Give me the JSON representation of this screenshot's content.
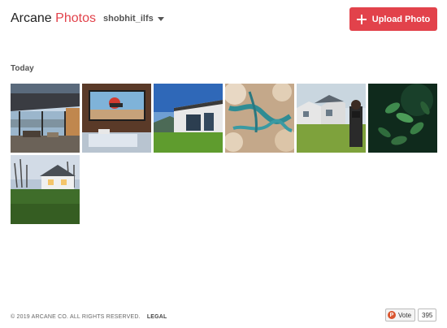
{
  "header": {
    "brand_part1": "Arcane",
    "brand_part2": "Photos",
    "username": "shobhit_ilfs",
    "upload_label": "Upload Photo"
  },
  "colors": {
    "accent": "#e2424b",
    "text_dark": "#1f1f1f"
  },
  "gallery": {
    "section_title": "Today",
    "photos": [
      {
        "subject": "modern-house-interior"
      },
      {
        "subject": "tv-room-motocross"
      },
      {
        "subject": "modern-house-lawn"
      },
      {
        "subject": "aerial-river-clouds"
      },
      {
        "subject": "houses-photographer"
      },
      {
        "subject": "green-leaves"
      },
      {
        "subject": "house-dusk-lawn"
      }
    ]
  },
  "footer": {
    "copyright": "© 2019 ARCANE CO. ALL RIGHTS RESERVED.",
    "legal": "LEGAL"
  },
  "vote": {
    "logo": "P",
    "label": "Vote",
    "count": "395"
  }
}
